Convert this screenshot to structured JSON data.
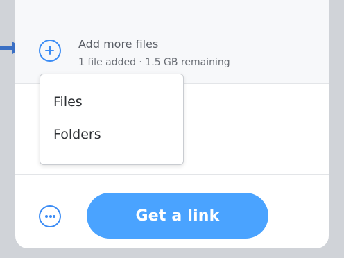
{
  "add_files": {
    "icon": "plus-circle-icon",
    "title": "Add more files",
    "subtitle": "1 file added · 1.5 GB remaining"
  },
  "dropdown": {
    "items": [
      {
        "label": "Files"
      },
      {
        "label": "Folders"
      }
    ]
  },
  "footer": {
    "more_icon": "more-options-icon",
    "link_button_label": "Get a link"
  },
  "colors": {
    "accent": "#3b8cf5",
    "button": "#4aa3ff",
    "arrow": "#3a6fc4"
  }
}
